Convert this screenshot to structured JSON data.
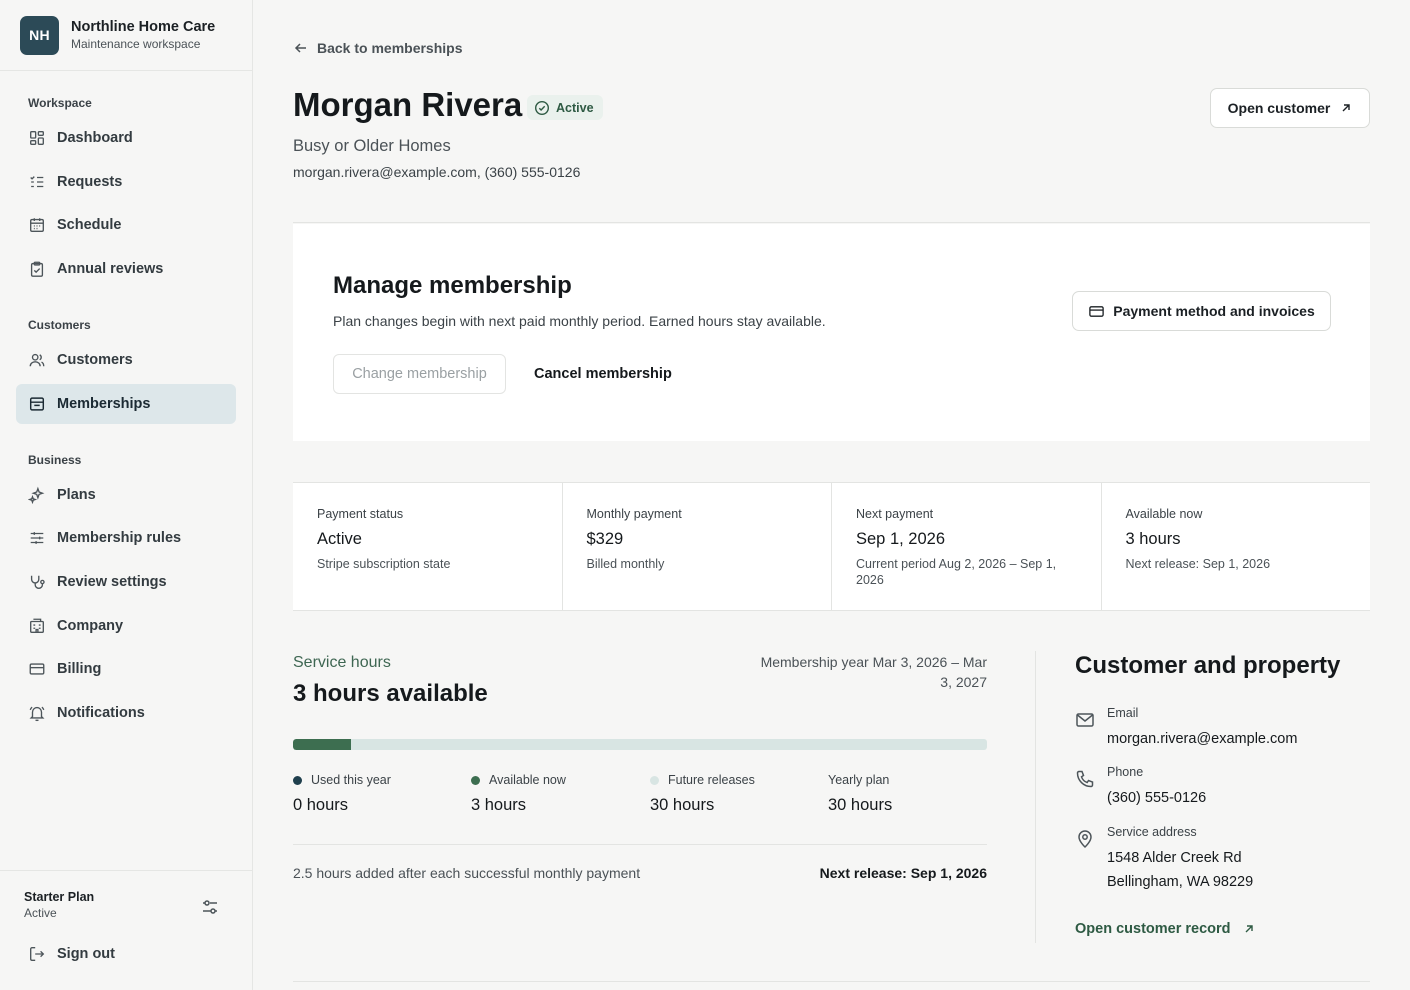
{
  "brand": {
    "initials": "NH",
    "name": "Northline Home Care",
    "subtitle": "Maintenance workspace"
  },
  "sidebar": {
    "sections": [
      {
        "heading": "Workspace",
        "items": [
          {
            "label": "Dashboard",
            "icon": "dashboard-icon"
          },
          {
            "label": "Requests",
            "icon": "list-icon"
          },
          {
            "label": "Schedule",
            "icon": "calendar-icon"
          },
          {
            "label": "Annual reviews",
            "icon": "clipboard-icon"
          }
        ]
      },
      {
        "heading": "Customers",
        "items": [
          {
            "label": "Customers",
            "icon": "users-icon"
          },
          {
            "label": "Memberships",
            "icon": "membership-icon",
            "active": true
          }
        ]
      },
      {
        "heading": "Business",
        "items": [
          {
            "label": "Plans",
            "icon": "sparkles-icon"
          },
          {
            "label": "Membership rules",
            "icon": "sliders-icon"
          },
          {
            "label": "Review settings",
            "icon": "stethoscope-icon"
          },
          {
            "label": "Company",
            "icon": "building-icon"
          },
          {
            "label": "Billing",
            "icon": "credit-card-icon"
          },
          {
            "label": "Notifications",
            "icon": "bell-icon"
          }
        ]
      }
    ],
    "plan": {
      "name": "Starter Plan",
      "status": "Active"
    },
    "sign_out": "Sign out"
  },
  "header": {
    "back_label": "Back to memberships",
    "title": "Morgan Rivera",
    "status": "Active",
    "subtitle": "Busy or Older Homes",
    "contact": "morgan.rivera@example.com, (360) 555-0126",
    "open_customer": "Open customer"
  },
  "manage": {
    "title": "Manage membership",
    "description": "Plan changes begin with next paid monthly period. Earned hours stay available.",
    "change_label": "Change membership",
    "cancel_label": "Cancel membership",
    "payment_label": "Payment method and invoices"
  },
  "stats": [
    {
      "label": "Payment status",
      "value": "Active",
      "note": "Stripe subscription state"
    },
    {
      "label": "Monthly payment",
      "value": "$329",
      "note": "Billed monthly"
    },
    {
      "label": "Next payment",
      "value": "Sep 1, 2026",
      "note": "Current period Aug 2, 2026 – Sep 1, 2026"
    },
    {
      "label": "Available now",
      "value": "3 hours",
      "note": "Next release: Sep 1, 2026"
    }
  ],
  "service_hours": {
    "label": "Service hours",
    "title": "3 hours available",
    "year": "Membership year Mar 3, 2026 – Mar 3, 2027",
    "progress_fraction": 0.083,
    "colors": {
      "used": "#1f3f4d",
      "available": "#3d6e50",
      "future": "#d8e5e3"
    },
    "legend": [
      {
        "label": "Used this year",
        "value": "0 hours",
        "dot": "used"
      },
      {
        "label": "Available now",
        "value": "3 hours",
        "dot": "available"
      },
      {
        "label": "Future releases",
        "value": "30 hours",
        "dot": "future"
      },
      {
        "label": "Yearly plan",
        "value": "30 hours",
        "dot": "none"
      }
    ],
    "footer": "2.5 hours added after each successful monthly payment",
    "next_release": "Next release: Sep 1, 2026"
  },
  "customer_property": {
    "title": "Customer and property",
    "email_label": "Email",
    "email": "morgan.rivera@example.com",
    "phone_label": "Phone",
    "phone": "(360) 555-0126",
    "address_label": "Service address",
    "address_line1": "1548 Alder Creek Rd",
    "address_line2": "Bellingham, WA 98229",
    "open_record": "Open customer record"
  }
}
